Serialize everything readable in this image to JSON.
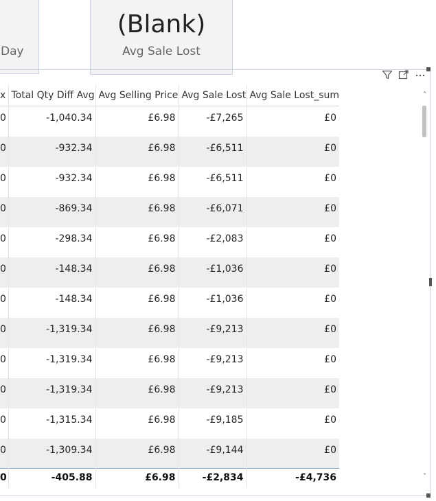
{
  "cards": {
    "day_label": "Day",
    "blank_value": "(Blank)",
    "blank_label": "Avg Sale Lost"
  },
  "table": {
    "columns": [
      "x",
      "Total Qty Diff Avg",
      "Avg Selling Price",
      "Avg Sale Lost",
      "Avg Sale Lost_sum"
    ],
    "rows": [
      [
        "0",
        "-1,040.34",
        "£6.98",
        "-£7,265",
        "£0"
      ],
      [
        "0",
        "-932.34",
        "£6.98",
        "-£6,511",
        "£0"
      ],
      [
        "0",
        "-932.34",
        "£6.98",
        "-£6,511",
        "£0"
      ],
      [
        "0",
        "-869.34",
        "£6.98",
        "-£6,071",
        "£0"
      ],
      [
        "0",
        "-298.34",
        "£6.98",
        "-£2,083",
        "£0"
      ],
      [
        "0",
        "-148.34",
        "£6.98",
        "-£1,036",
        "£0"
      ],
      [
        "0",
        "-148.34",
        "£6.98",
        "-£1,036",
        "£0"
      ],
      [
        "0",
        "-1,319.34",
        "£6.98",
        "-£9,213",
        "£0"
      ],
      [
        "0",
        "-1,319.34",
        "£6.98",
        "-£9,213",
        "£0"
      ],
      [
        "0",
        "-1,319.34",
        "£6.98",
        "-£9,213",
        "£0"
      ],
      [
        "0",
        "-1,315.34",
        "£6.98",
        "-£9,185",
        "£0"
      ],
      [
        "0",
        "-1,309.34",
        "£6.98",
        "-£9,144",
        "£0"
      ]
    ],
    "total": [
      "0",
      "-405.88",
      "£6.98",
      "-£2,834",
      "-£4,736"
    ]
  },
  "icons": {
    "filter": "filter-icon",
    "focus": "focus-mode-icon",
    "more": "more-options-icon"
  },
  "scrollbar": {
    "up": "˄",
    "down": "˅"
  }
}
